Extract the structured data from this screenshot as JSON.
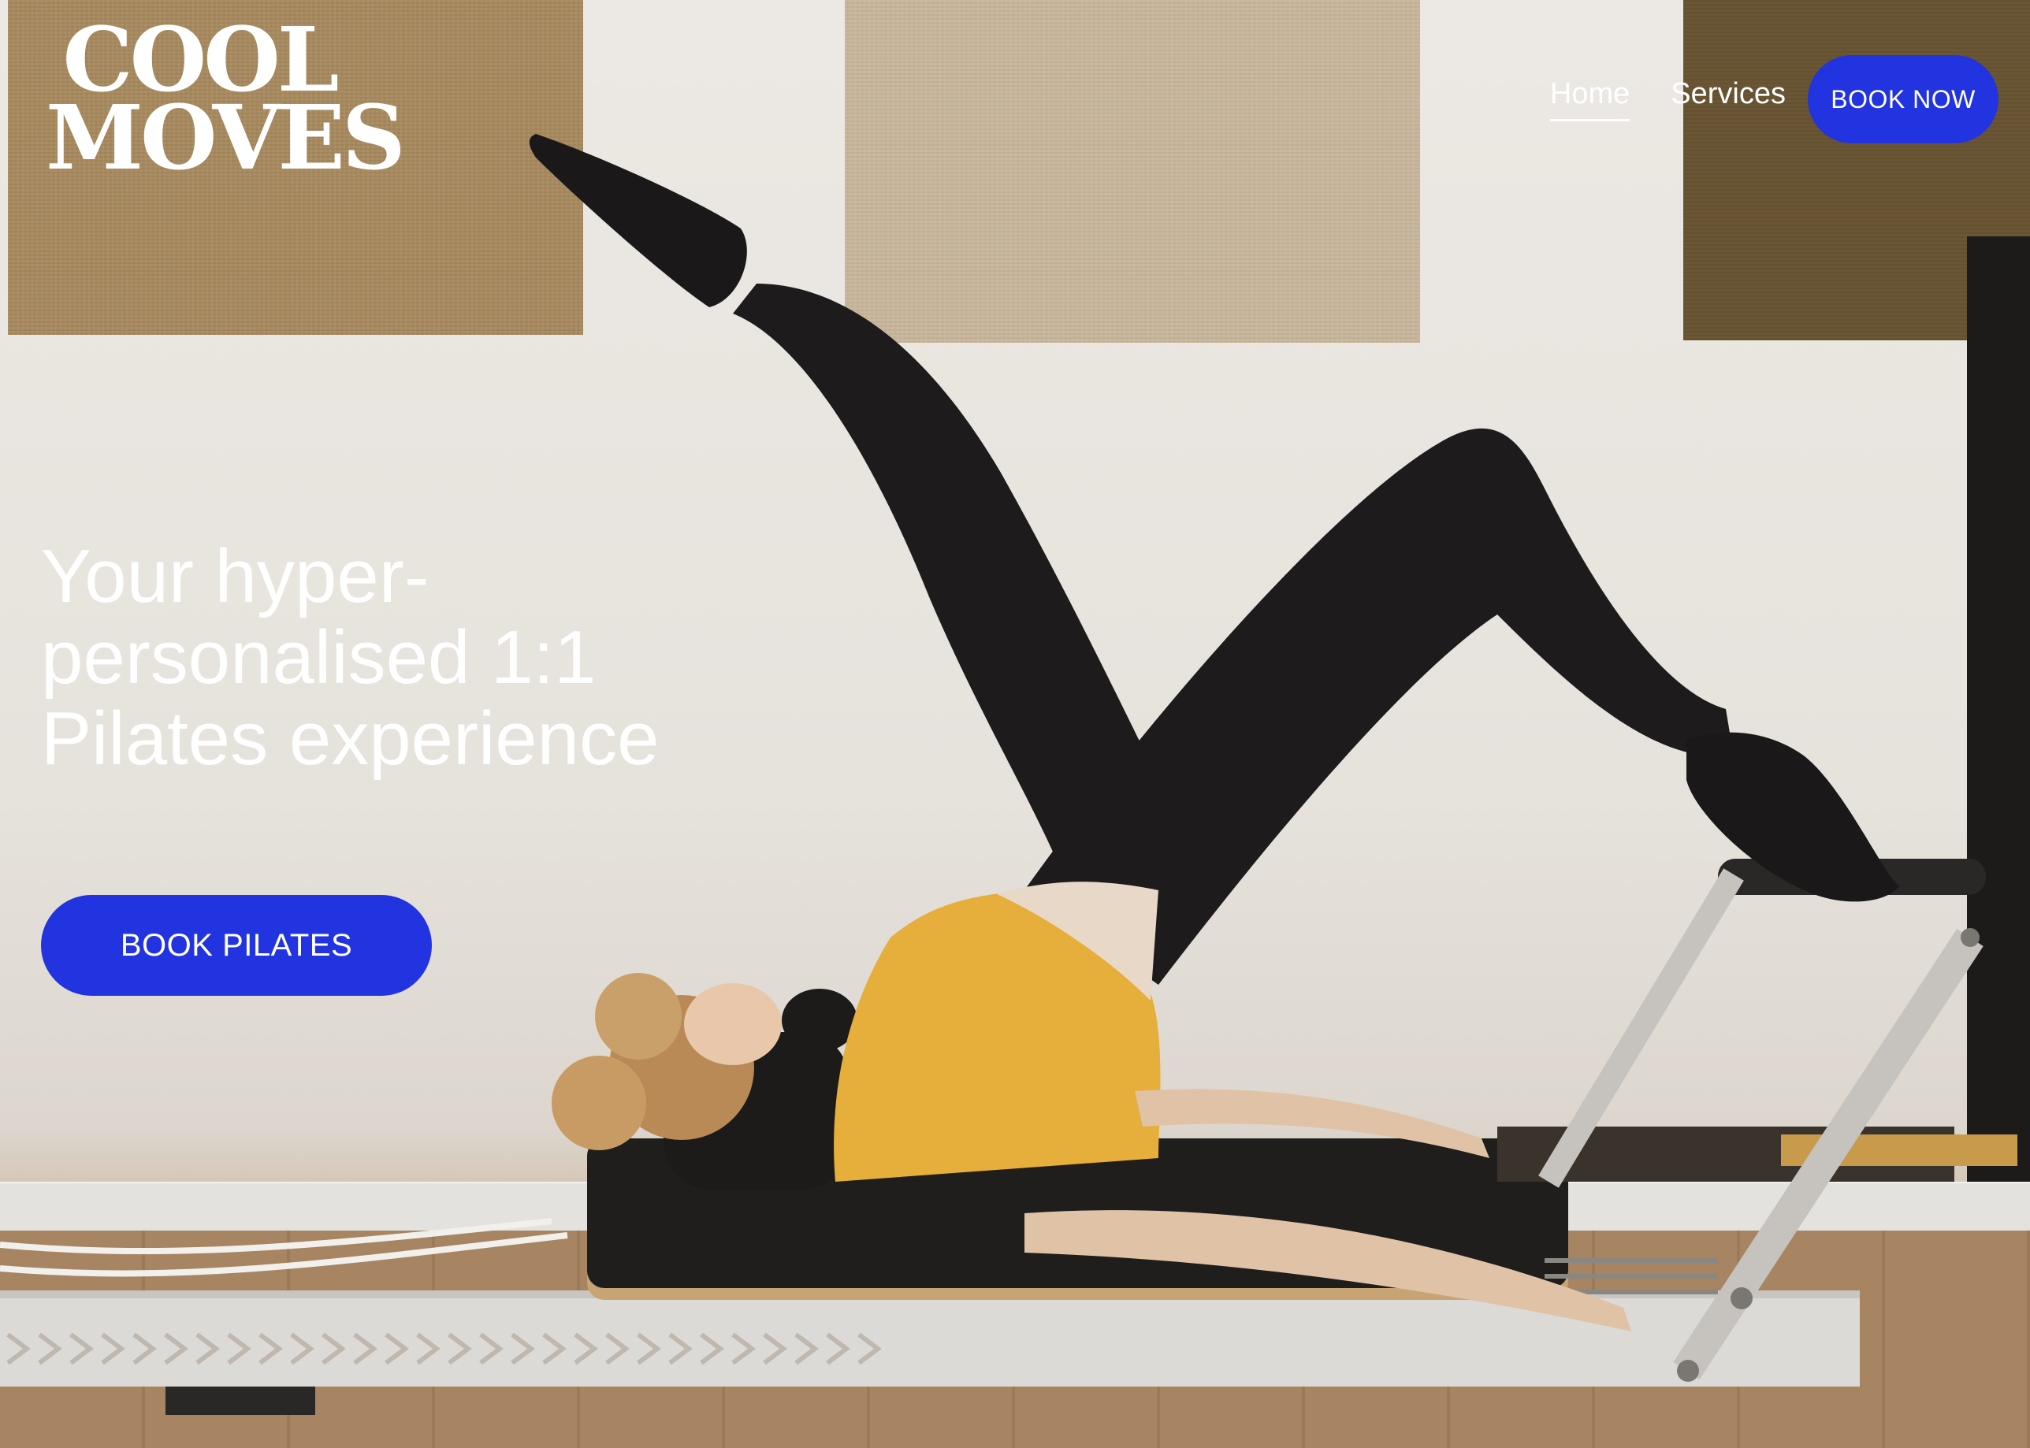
{
  "brand": {
    "logo_line1": "COOL",
    "logo_line2": "MOVES"
  },
  "nav": {
    "items": [
      {
        "label": "Home",
        "active": true
      },
      {
        "label": "Services",
        "active": false
      }
    ],
    "cta_label": "BOOK NOW"
  },
  "hero": {
    "headline_line1": "Your hyper-",
    "headline_line2": "personalised 1:1",
    "headline_line3": "Pilates experience",
    "cta_label": "BOOK PILATES"
  },
  "colors": {
    "accent": "#2233e0",
    "text": "#ffffff"
  }
}
